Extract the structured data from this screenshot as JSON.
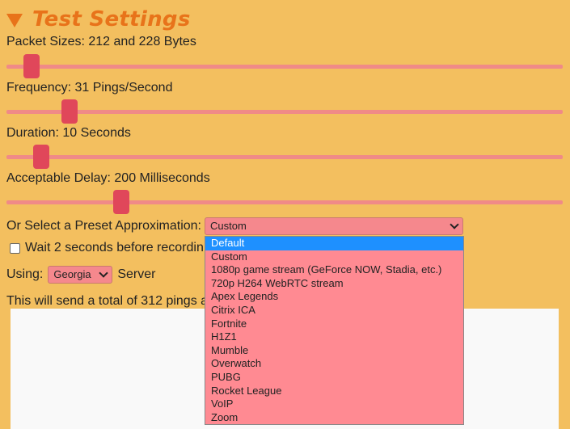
{
  "section": {
    "title": "Test Settings"
  },
  "settings": {
    "packet_sizes_label": "Packet Sizes: 212 and 228 Bytes",
    "packet_sizes_value": 0.045,
    "frequency_label": "Frequency: 31 Pings/Second",
    "frequency_value": 0.113,
    "duration_label": "Duration: 10 Seconds",
    "duration_value": 0.062,
    "delay_label": "Acceptable Delay: 200 Milliseconds",
    "delay_value": 0.207
  },
  "preset": {
    "label": "Or Select a Preset Approximation:",
    "selected": "Custom",
    "options": [
      "Default",
      "Custom",
      "1080p game stream (GeForce NOW, Stadia, etc.)",
      "720p H264 WebRTC stream",
      "Apex Legends",
      "Citrix ICA",
      "Fortnite",
      "H1Z1",
      "Mumble",
      "Overwatch",
      "PUBG",
      "Rocket League",
      "VoIP",
      "Zoom"
    ],
    "highlighted": "Default"
  },
  "wait": {
    "label": "Wait 2 seconds before recordin",
    "checked": false
  },
  "server": {
    "using_label": "Using:",
    "selected": "Georgia",
    "suffix": "Server"
  },
  "summary": {
    "text": "This will send a total of 312 pings a"
  },
  "colors": {
    "background": "#f3bf5f",
    "title": "#e8731a",
    "thumb": "#e0475a",
    "track": "#f08a87",
    "dropdown_bg": "#ff8a92",
    "highlight": "#1e90ff"
  }
}
